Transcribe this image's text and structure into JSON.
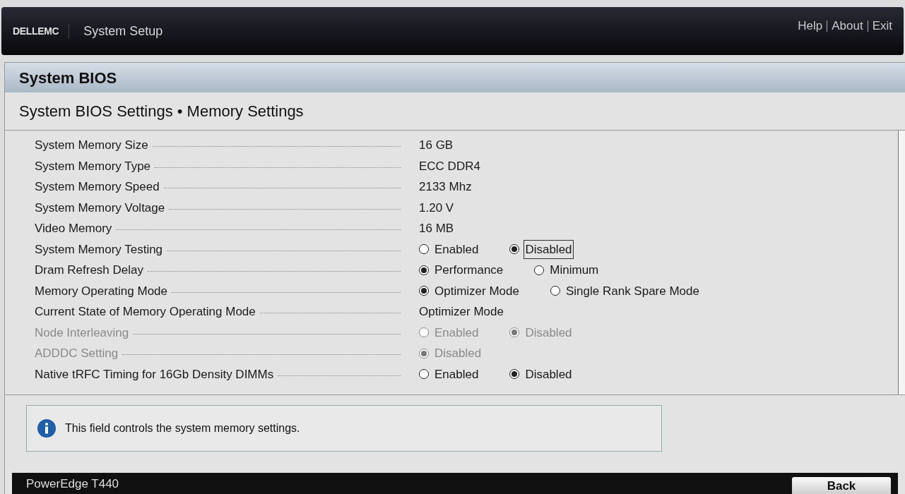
{
  "header": {
    "brand": "DELLEMC",
    "title": "System Setup",
    "links": [
      "Help",
      "About",
      "Exit"
    ]
  },
  "page_title": "System BIOS",
  "breadcrumb": "System BIOS Settings • Memory Settings",
  "settings": [
    {
      "kind": "value",
      "label": "System Memory Size",
      "disabled": false,
      "value": "16 GB"
    },
    {
      "kind": "value",
      "label": "System Memory Type",
      "disabled": false,
      "value": "ECC DDR4"
    },
    {
      "kind": "value",
      "label": "System Memory Speed",
      "disabled": false,
      "value": "2133 Mhz"
    },
    {
      "kind": "value",
      "label": "System Memory Voltage",
      "disabled": false,
      "value": "1.20 V"
    },
    {
      "kind": "value",
      "label": "Video Memory",
      "disabled": false,
      "value": "16 MB"
    },
    {
      "kind": "radio",
      "label": "System Memory Testing",
      "disabled": false,
      "options": [
        {
          "label": "Enabled",
          "selected": false,
          "focused": false
        },
        {
          "label": "Disabled",
          "selected": true,
          "focused": true
        }
      ]
    },
    {
      "kind": "radio",
      "label": "Dram Refresh Delay",
      "disabled": false,
      "options": [
        {
          "label": "Performance",
          "selected": true,
          "focused": false
        },
        {
          "label": "Minimum",
          "selected": false,
          "focused": false
        }
      ]
    },
    {
      "kind": "radio",
      "label": "Memory Operating Mode",
      "disabled": false,
      "options": [
        {
          "label": "Optimizer Mode",
          "selected": true,
          "focused": false
        },
        {
          "label": "Single Rank Spare Mode",
          "selected": false,
          "focused": false
        }
      ]
    },
    {
      "kind": "value",
      "label": "Current State of Memory Operating Mode",
      "disabled": false,
      "value": "Optimizer Mode"
    },
    {
      "kind": "radio",
      "label": "Node Interleaving",
      "disabled": true,
      "options": [
        {
          "label": "Enabled",
          "selected": false,
          "focused": false
        },
        {
          "label": "Disabled",
          "selected": true,
          "focused": false
        }
      ]
    },
    {
      "kind": "radio",
      "label": "ADDDC Setting",
      "disabled": true,
      "options": [
        {
          "label": "Disabled",
          "selected": true,
          "focused": false
        }
      ]
    },
    {
      "kind": "radio",
      "label": "Native tRFC Timing for 16Gb Density DIMMs",
      "disabled": false,
      "options": [
        {
          "label": "Enabled",
          "selected": false,
          "focused": false
        },
        {
          "label": "Disabled",
          "selected": true,
          "focused": false
        }
      ]
    }
  ],
  "help_text": "This field controls the system memory settings.",
  "footer": {
    "model": "PowerEdge T440",
    "button": "Back"
  }
}
